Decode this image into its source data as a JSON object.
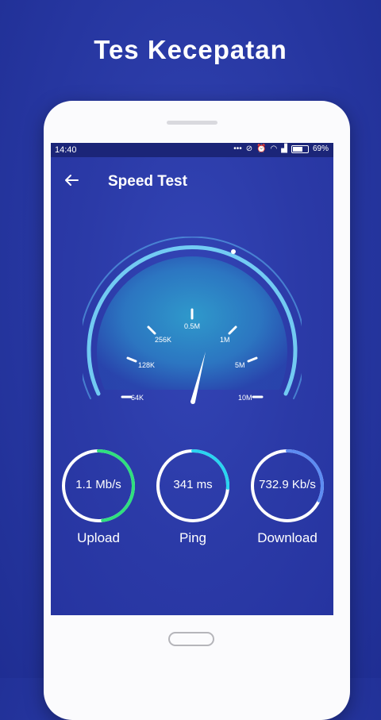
{
  "promo": {
    "headline": "Tes Kecepatan"
  },
  "status_bar": {
    "time": "14:40",
    "battery": "69%"
  },
  "app_bar": {
    "title": "Speed Test"
  },
  "gauge": {
    "labels": [
      "64K",
      "128K",
      "256K",
      "0.5M",
      "1M",
      "5M",
      "10M"
    ],
    "needle_label_position": "between 0.5M and 1M"
  },
  "metrics": [
    {
      "value": "1.1 Mb/s",
      "label": "Upload",
      "color": "#2fe07e",
      "progress": 0.48
    },
    {
      "value": "341 ms",
      "label": "Ping",
      "color": "#29d4f0",
      "progress": 0.26
    },
    {
      "value": "732.9 Kb/s",
      "label": "Download",
      "color": "#5d8cf2",
      "progress": 0.32
    }
  ],
  "colors": {
    "background": "#2a3aa6",
    "screen": "#2b3aa7",
    "status_bar": "#1b2578"
  }
}
